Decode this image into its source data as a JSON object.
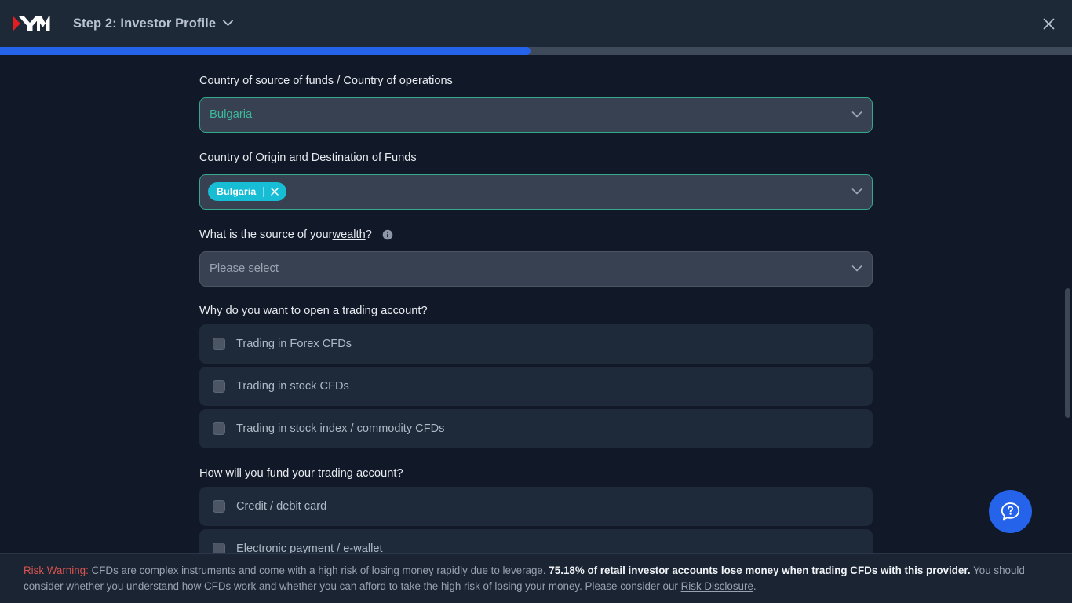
{
  "header": {
    "logo_alt": "XM",
    "step_title": "Step 2: Investor Profile",
    "chevron": "chevron-down",
    "close": "×"
  },
  "progress": {
    "percent": 49.5
  },
  "form": {
    "country_source": {
      "label": "Country of source of funds / Country of operations",
      "value": "Bulgaria"
    },
    "country_origin": {
      "label": "Country of Origin and Destination of Funds",
      "chips": [
        "Bulgaria"
      ],
      "chip_remove": "×"
    },
    "source_of_wealth": {
      "label_prefix": "What is the source of your ",
      "label_underlined": "wealth",
      "label_suffix": "?",
      "placeholder": "Please select"
    },
    "why_open": {
      "label": "Why do you want to open a trading account?",
      "options": [
        "Trading in Forex CFDs",
        "Trading in stock CFDs",
        "Trading in stock index / commodity CFDs"
      ]
    },
    "how_fund": {
      "label": "How will you fund your trading account?",
      "options": [
        "Credit / debit card",
        "Electronic payment / e-wallet"
      ]
    }
  },
  "help": {
    "label": "help-chat"
  },
  "risk": {
    "prefix": "Risk Warning:",
    "body1": " CFDs are complex instruments and come with a high risk of losing money rapidly due to leverage. ",
    "bold": "75.18% of retail investor accounts lose money when trading CFDs with this provider.",
    "body2": " You should consider whether you understand how CFDs work and whether you can afford to take the high risk of losing your money. Please consider our ",
    "link": "Risk Disclosure",
    "period": "."
  },
  "colors": {
    "page_bg": "#111827",
    "header_bg": "#1e2938",
    "accent_blue": "#2563eb",
    "accent_teal": "#35a98c",
    "chip_cyan": "#17bdd4",
    "risk_red": "#d9534f"
  }
}
